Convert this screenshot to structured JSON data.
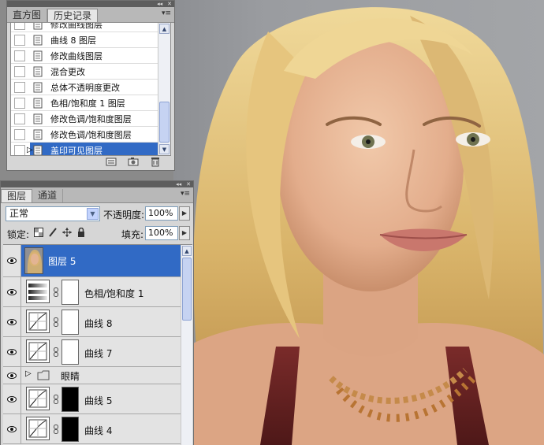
{
  "history_panel": {
    "tabs": [
      {
        "label": "直方图",
        "active": false
      },
      {
        "label": "历史记录",
        "active": true
      }
    ],
    "items": [
      {
        "label": "修改曲线图层",
        "selected": false
      },
      {
        "label": "曲线 8 图层",
        "selected": false
      },
      {
        "label": "修改曲线图层",
        "selected": false
      },
      {
        "label": "混合更改",
        "selected": false
      },
      {
        "label": "总体不透明度更改",
        "selected": false
      },
      {
        "label": "色相/饱和度 1 图层",
        "selected": false
      },
      {
        "label": "修改色调/饱和度图层",
        "selected": false
      },
      {
        "label": "修改色调/饱和度图层",
        "selected": false
      },
      {
        "label": "盖印可见图层",
        "selected": true
      }
    ],
    "footer_icons": [
      "new-document-icon",
      "snapshot-camera-icon",
      "trash-icon"
    ]
  },
  "layers_panel": {
    "tabs": [
      {
        "label": "图层",
        "active": true
      },
      {
        "label": "通道",
        "active": false
      }
    ],
    "blend_mode": "正常",
    "opacity_label": "不透明度:",
    "opacity_value": "100%",
    "lock_label": "锁定:",
    "fill_label": "填充:",
    "fill_value": "100%",
    "layers": [
      {
        "name": "图层 5",
        "type": "pixel",
        "selected": true,
        "visible": true
      },
      {
        "name": "色相/饱和度 1",
        "type": "hue-saturation",
        "mask": "white",
        "selected": false,
        "visible": true
      },
      {
        "name": "曲线 8",
        "type": "curves",
        "mask": "white",
        "selected": false,
        "visible": true
      },
      {
        "name": "曲线 7",
        "type": "curves",
        "mask": "white",
        "selected": false,
        "visible": true
      },
      {
        "name": "眼睛",
        "type": "group",
        "selected": false,
        "visible": true
      },
      {
        "name": "曲线 5",
        "type": "curves",
        "mask": "black",
        "selected": false,
        "visible": true
      },
      {
        "name": "曲线 4",
        "type": "curves",
        "mask": "black",
        "selected": false,
        "visible": true
      }
    ]
  },
  "colors": {
    "selection": "#316ac5",
    "panel_bg": "#d6d6d6",
    "canvas_bg": "#9a9ca0"
  }
}
